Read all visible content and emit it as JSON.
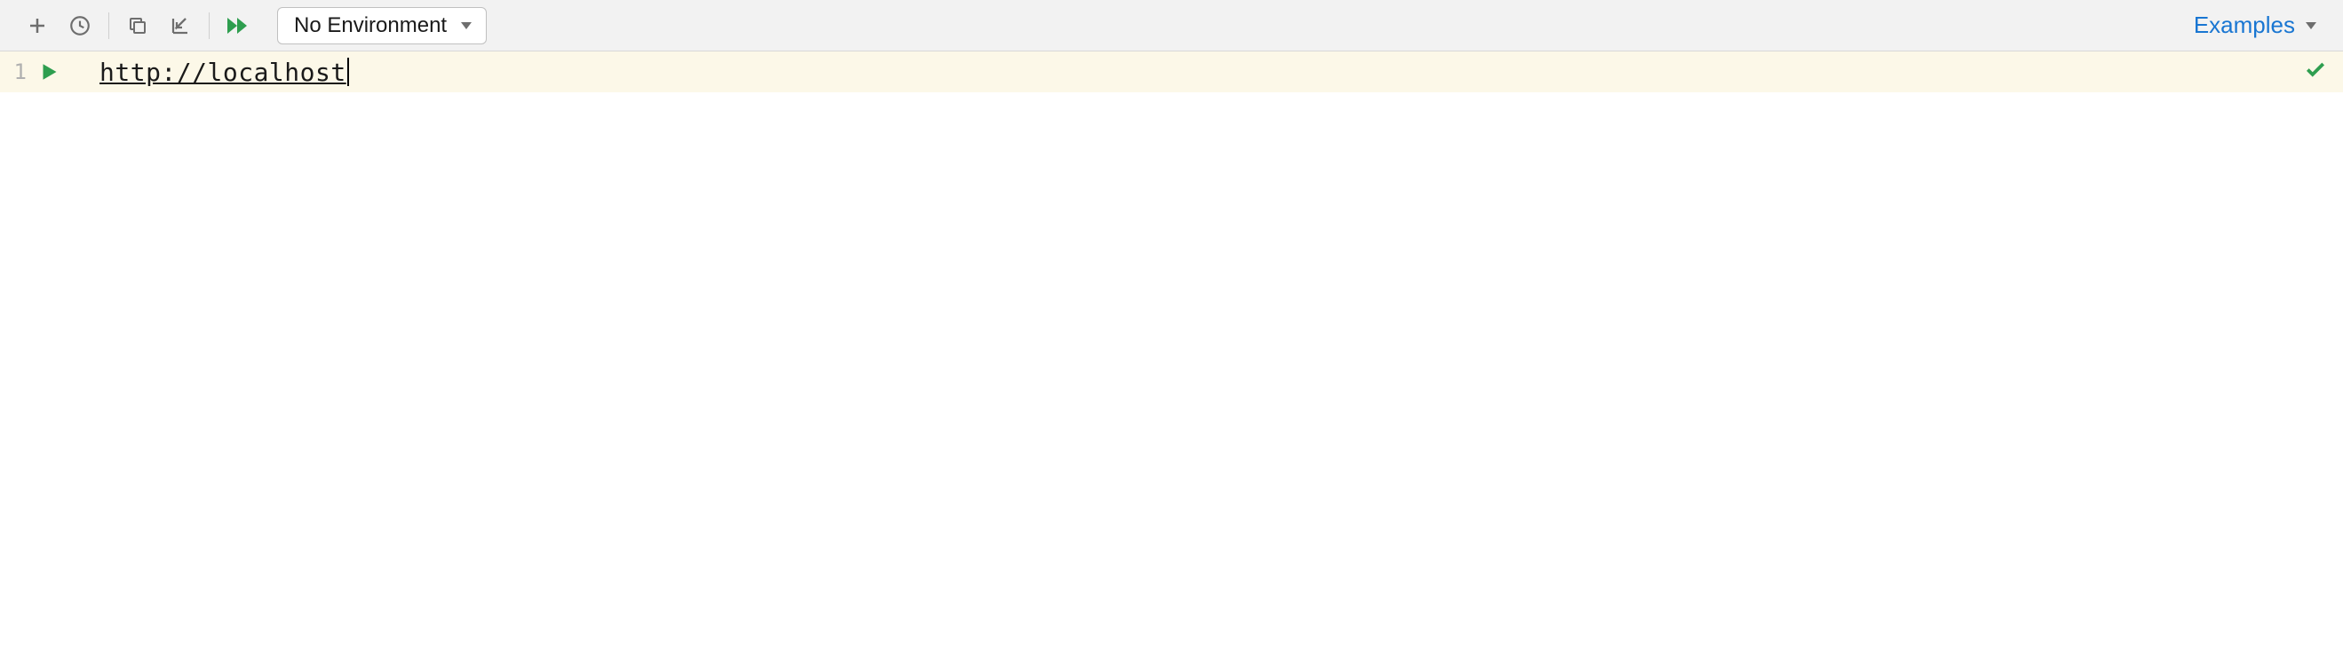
{
  "toolbar": {
    "environment_label": "No Environment",
    "examples_label": "Examples"
  },
  "editor": {
    "line_number": "1",
    "code_content": "http://localhost"
  }
}
